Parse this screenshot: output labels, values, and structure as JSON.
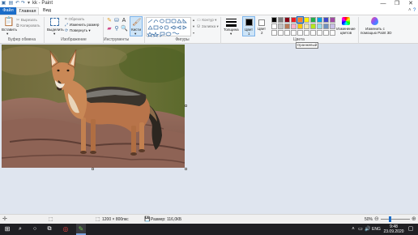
{
  "window": {
    "title": "kk - Paint",
    "minimize_glyph": "—",
    "maximize_glyph": "❐",
    "close_glyph": "✕"
  },
  "tabs": [
    {
      "label": "Файл"
    },
    {
      "label": "Главная"
    },
    {
      "label": "Вид"
    }
  ],
  "clipboard": {
    "paste_label": "Вставить",
    "paste_arrow": "▾",
    "cut_label": "Вырезать",
    "copy_label": "Копировать",
    "group_label": "Буфер обмена"
  },
  "image": {
    "select_label": "Выделить",
    "select_arrow": "▾",
    "crop_label": "Обрезать",
    "resize_label": "Изменить размер",
    "rotate_label": "Повернуть ▾",
    "group_label": "Изображение"
  },
  "tools": {
    "group_label": "Инструменты"
  },
  "brushes": {
    "label": "Кисти",
    "arrow": "▾"
  },
  "shapes": {
    "outline_label": "Контур ▾",
    "fill_label": "Заливка ▾",
    "group_label": "Фигуры"
  },
  "size": {
    "label": "Толщина",
    "arrow": "▾"
  },
  "colors": {
    "color1_label": "Цвет",
    "color1_num": "1",
    "color2_label": "Цвет",
    "color2_num": "2",
    "edit_label_1": "Изменение",
    "edit_label_2": "цветов",
    "group_label": "Цвета",
    "palette_row1": [
      "#000000",
      "#7f7f7f",
      "#880015",
      "#ed1c24",
      "#ff7f27",
      "#fff200",
      "#22b14c",
      "#00a2e8",
      "#3f48cc",
      "#a349a4"
    ],
    "palette_row2": [
      "#ffffff",
      "#c3c3c3",
      "#b97a57",
      "#ffaec9",
      "#ffc90e",
      "#efe4b0",
      "#b5e61d",
      "#99d9ea",
      "#7092be",
      "#c8bfe7"
    ],
    "palette_row3": [
      "#ffffff",
      "#ffffff",
      "#ffffff",
      "#ffffff",
      "#ffffff",
      "#ffffff",
      "#ffffff",
      "#ffffff",
      "#ffffff",
      "#ffffff"
    ],
    "color1_value": "#000000",
    "color2_value": "#ffffff"
  },
  "paint3d": {
    "label_1": "Изменить с",
    "label_2": "помощью Paint 3D"
  },
  "tooltip": "Оранжевый",
  "status": {
    "dimensions": "1200 × 800пкс",
    "size": "Размер: 116,0КБ",
    "zoom": "50%"
  },
  "taskbar": {
    "lang": "ENG",
    "time": "9:48",
    "date": "23.09.2020"
  }
}
